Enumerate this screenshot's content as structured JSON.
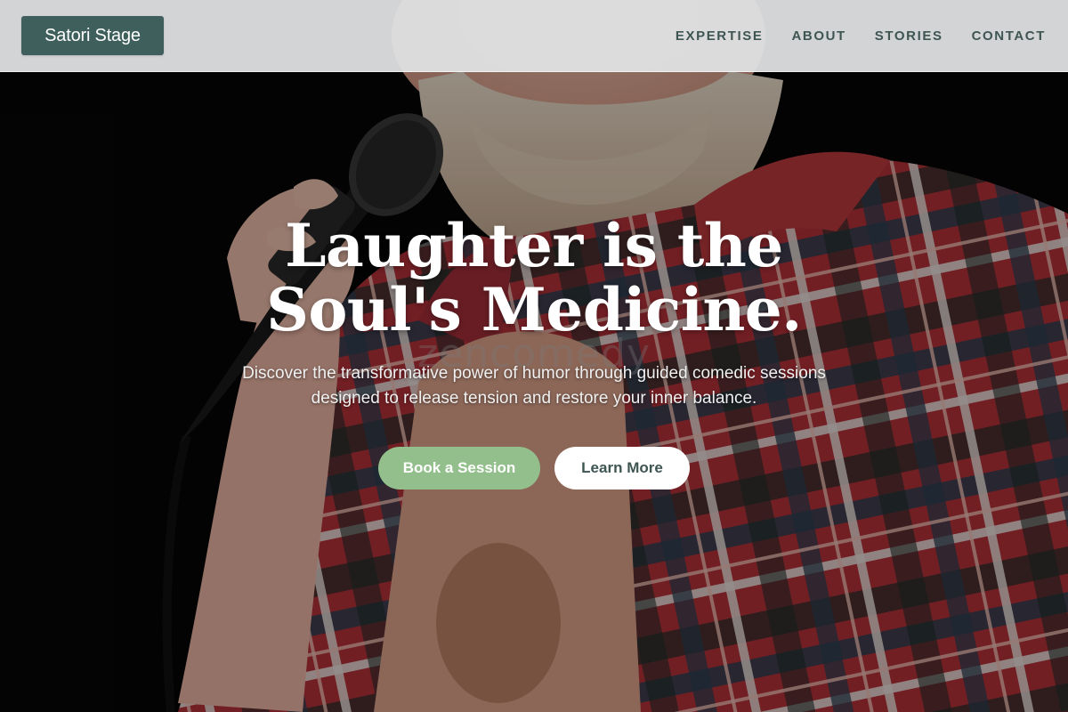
{
  "header": {
    "brand": "Satori Stage",
    "nav": [
      {
        "label": "EXPERTISE"
      },
      {
        "label": "ABOUT"
      },
      {
        "label": "STORIES"
      },
      {
        "label": "CONTACT"
      }
    ]
  },
  "hero": {
    "headline_line1": "Laughter is the",
    "headline_line2": "Soul's Medicine.",
    "subtext": "Discover the transformative power of humor through guided comedic sessions designed to release tension and restore your inner balance.",
    "watermark": "zencomedy",
    "primary_cta": "Book a Session",
    "secondary_cta": "Learn More"
  },
  "colors": {
    "brand": "#3e5f5c",
    "nav_text": "#3e5552",
    "primary_button": "#93bf8c",
    "secondary_button": "#ffffff",
    "header_background": "#e2e4e6"
  }
}
